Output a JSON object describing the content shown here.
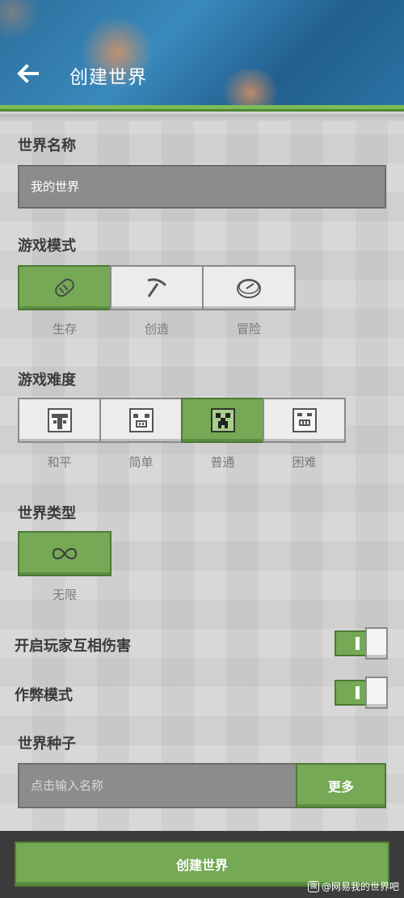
{
  "header": {
    "title": "创建世界"
  },
  "world_name": {
    "label": "世界名称",
    "value": "我的世界"
  },
  "game_mode": {
    "label": "游戏模式",
    "options": [
      {
        "label": "生存",
        "icon": "bread-icon",
        "selected": true
      },
      {
        "label": "创造",
        "icon": "pickaxe-icon",
        "selected": false
      },
      {
        "label": "冒险",
        "icon": "compass-icon",
        "selected": false
      }
    ]
  },
  "difficulty": {
    "label": "游戏难度",
    "options": [
      {
        "label": "和平",
        "icon": "peaceful-icon",
        "selected": false
      },
      {
        "label": "简单",
        "icon": "pig-icon",
        "selected": false
      },
      {
        "label": "普通",
        "icon": "creeper-icon",
        "selected": true
      },
      {
        "label": "困难",
        "icon": "ghast-icon",
        "selected": false
      }
    ]
  },
  "world_type": {
    "label": "世界类型",
    "options": [
      {
        "label": "无限",
        "icon": "infinity-icon",
        "selected": true
      }
    ]
  },
  "toggles": {
    "pvp": {
      "label": "开启玩家互相伤害",
      "on": true
    },
    "cheats": {
      "label": "作弊模式",
      "on": true
    }
  },
  "seed": {
    "label": "世界种子",
    "placeholder": "点击输入名称",
    "more_label": "更多"
  },
  "footer": {
    "create_label": "创建世界"
  },
  "watermark": {
    "text": "@网易我的世界吧"
  },
  "colors": {
    "accent": "#75a955",
    "accent_dark": "#4d7a35",
    "field": "#8c8c8c",
    "background": "#d3d3d3"
  }
}
